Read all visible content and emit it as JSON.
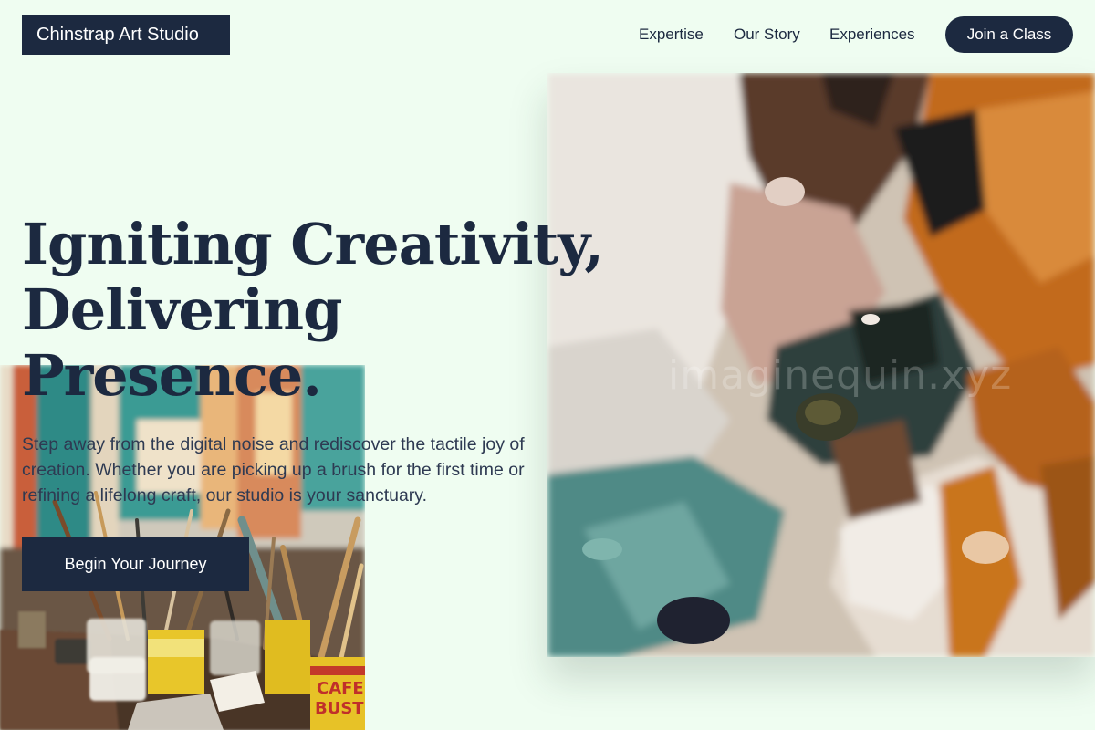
{
  "header": {
    "logo": "Chinstrap Art Studio",
    "nav": [
      "Expertise",
      "Our Story",
      "Experiences"
    ],
    "cta": "Join a Class"
  },
  "hero": {
    "title_lines": [
      "Igniting Creativity,",
      "Delivering",
      "Presence."
    ],
    "subtitle_lines": [
      "Step away from the digital noise and rediscover the tactile joy of",
      "creation. Whether you are picking up a brush for the first time or",
      "refining a lifelong craft, our studio is your sanctuary."
    ],
    "cta": "Begin Your Journey"
  },
  "images": {
    "studio": {
      "label": "Cafe Bustelo",
      "brand_lines": [
        "CAFE",
        "BUSTE"
      ]
    },
    "painting": {
      "watermark": "imaginequin.xyz"
    }
  },
  "colors": {
    "background": "#effdf1",
    "primary": "#1c2940",
    "primary_text": "#ffffff"
  }
}
